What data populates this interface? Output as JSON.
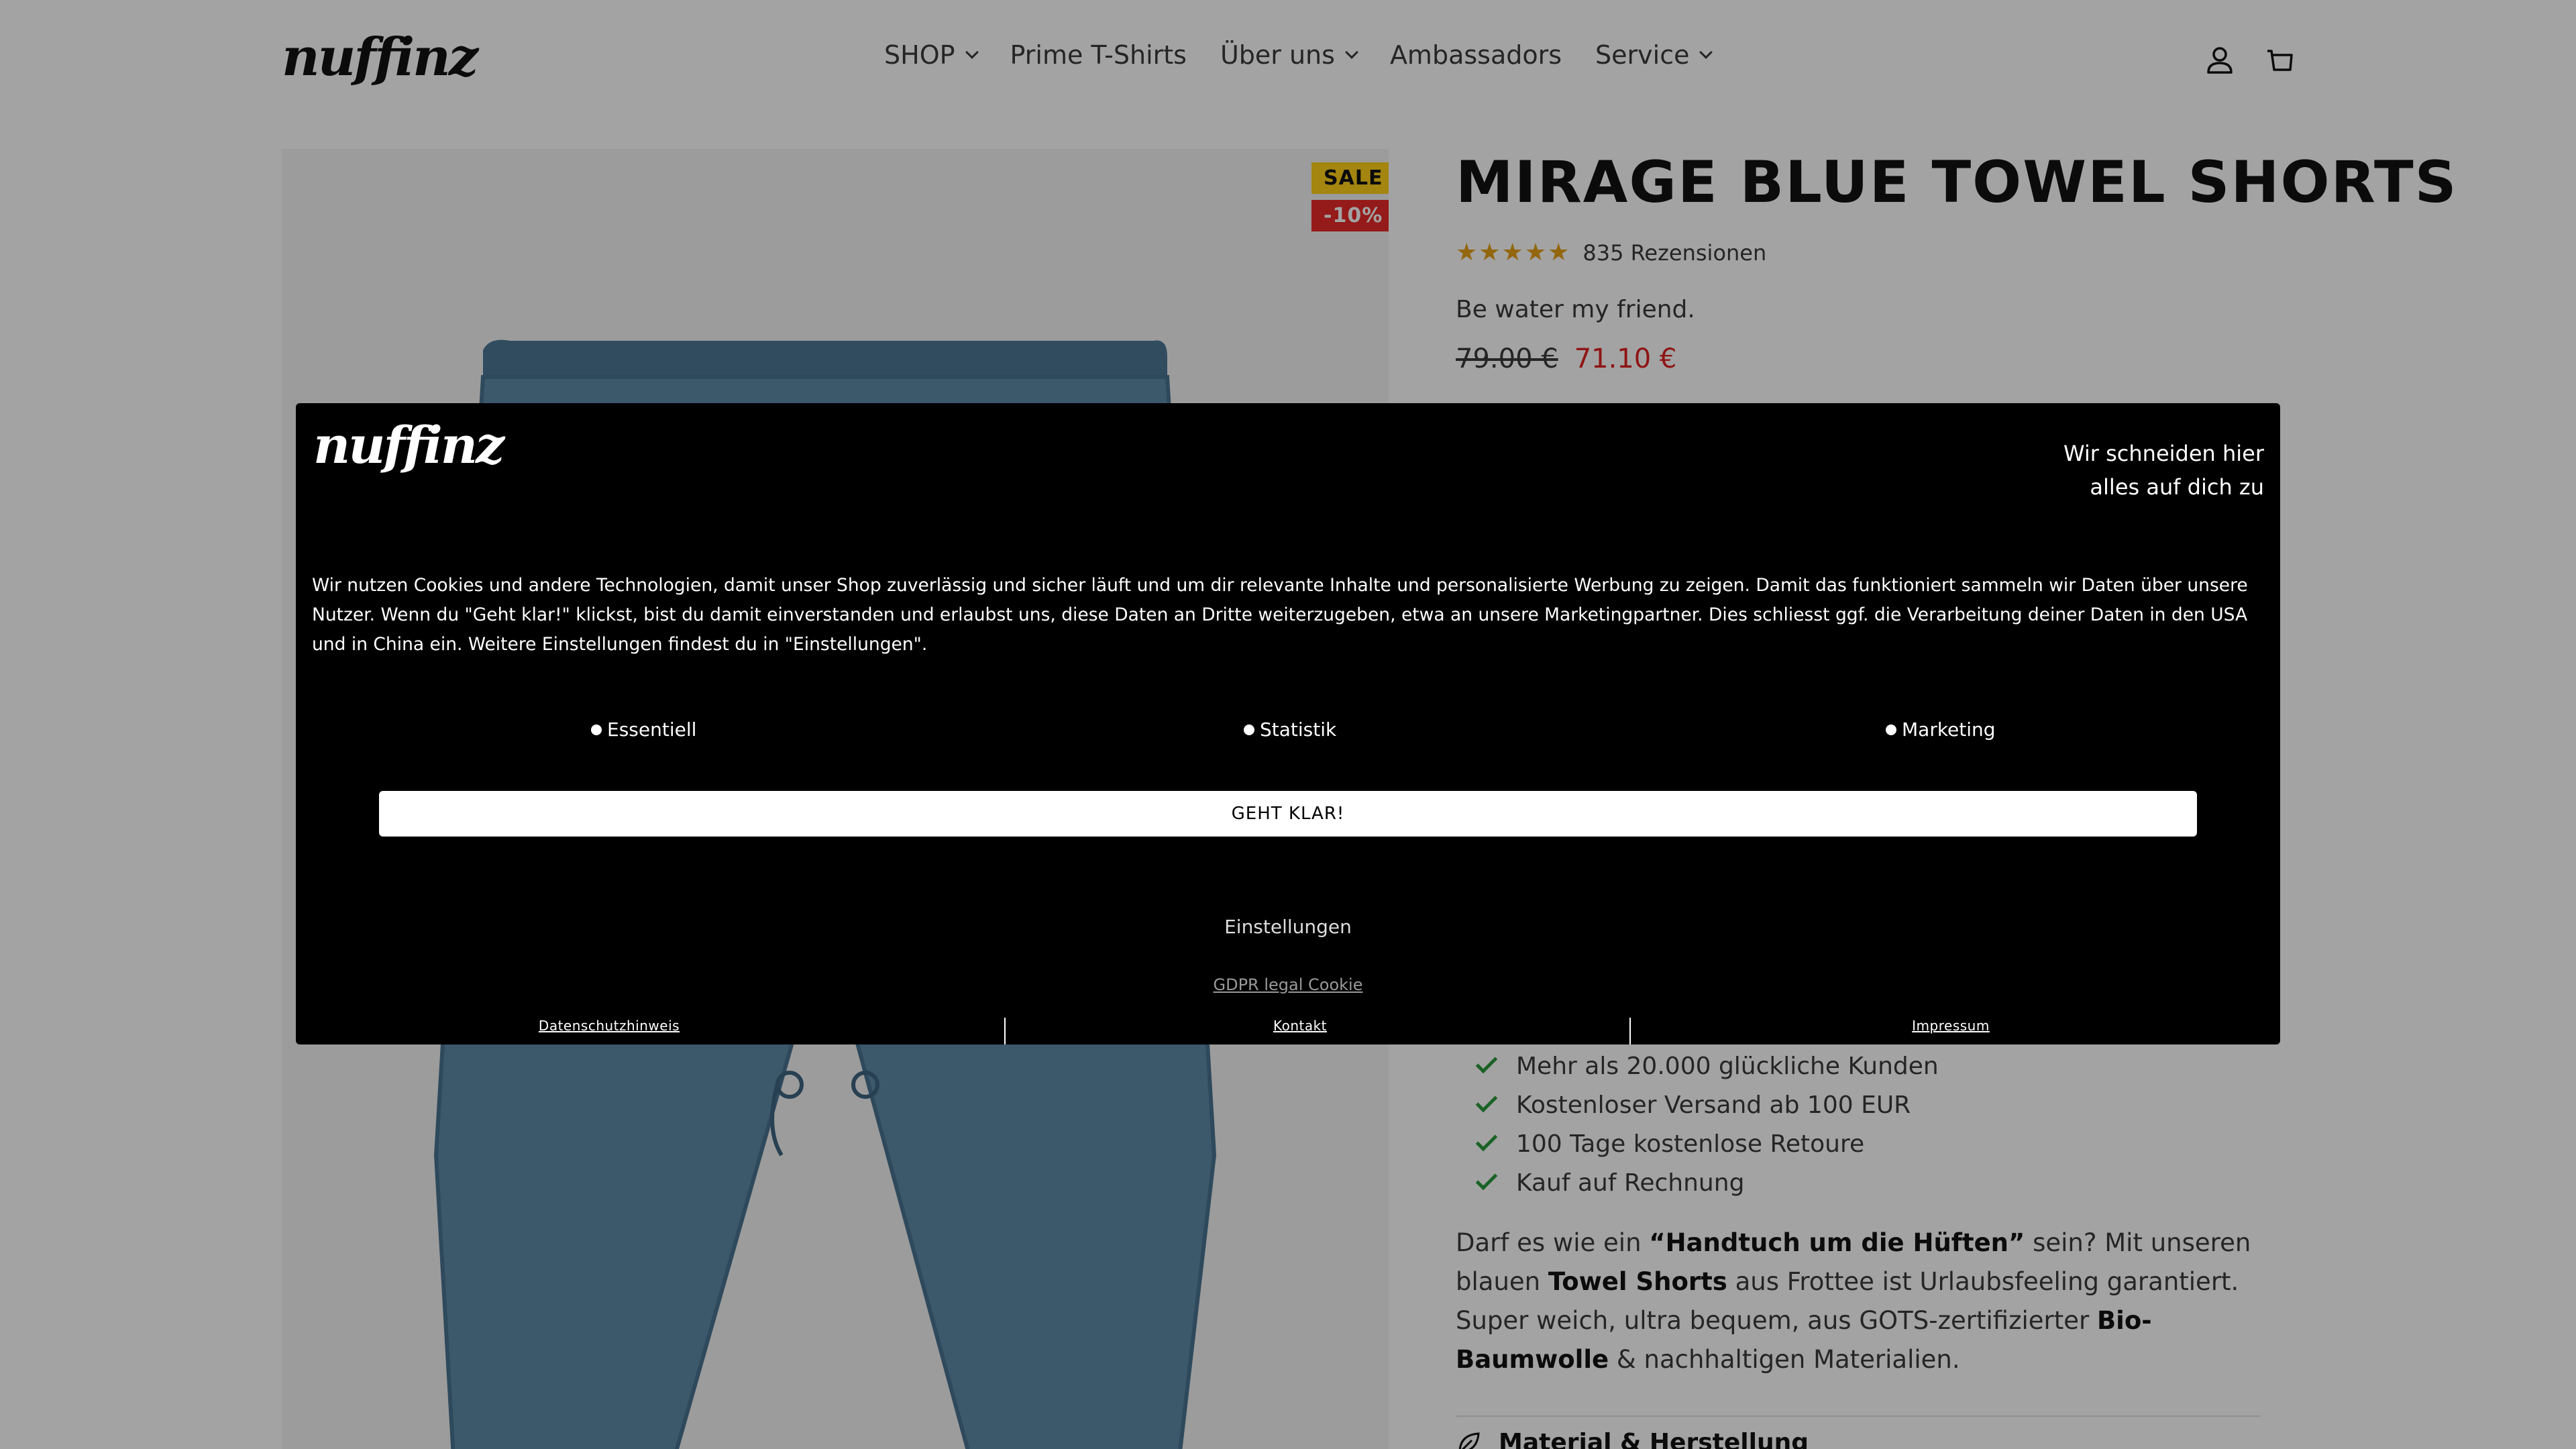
{
  "header": {
    "logo_text": "nuffinz",
    "nav": [
      {
        "label": "SHOP",
        "has_dropdown": true
      },
      {
        "label": "Prime T-Shirts",
        "has_dropdown": false
      },
      {
        "label": "Über uns",
        "has_dropdown": true
      },
      {
        "label": "Ambassadors",
        "has_dropdown": false
      },
      {
        "label": "Service",
        "has_dropdown": true
      }
    ],
    "icons": [
      "account-icon",
      "cart-icon"
    ]
  },
  "gallery": {
    "badge_sale": "SALE",
    "badge_discount": "-10%",
    "image_alt": "blue towel shorts product image"
  },
  "product": {
    "title": "MIRAGE BLUE TOWEL SHORTS",
    "stars": "★★★★★",
    "rating_value": 5,
    "reviews": "835 Rezensionen",
    "tagline": "Be water my friend.",
    "old_price": "79.00 €",
    "new_price": "71.10 €",
    "benefits": [
      "Mehr als 20.000 glückliche Kunden",
      "Kostenloser Versand ab 100 EUR",
      "100 Tage kostenlose Retoure",
      "Kauf auf Rechnung"
    ],
    "description": {
      "p1": "Darf es wie ein ",
      "b1": "“Handtuch um die Hüften”",
      "p2": " sein? Mit unseren blauen ",
      "b2": "Towel Shorts",
      "p3": " aus Frottee ist Urlaubsfeeling garantiert. Super weich, ultra bequem, aus GOTS-zertifizierter ",
      "b3": "Bio-Baumwolle",
      "p4": " & nachhaltigen Materialien."
    },
    "material_label": "Material & Herstellung"
  },
  "cookie": {
    "logo_text": "nuffinz",
    "headline_1": "Wir schneiden hier",
    "headline_2": "alles auf dich zu",
    "text": "Wir nutzen Cookies und andere Technologien, damit unser Shop zuverlässig und sicher läuft und um dir relevante Inhalte und personalisierte Werbung zu zeigen. Damit das funktioniert sammeln wir Daten über unsere Nutzer. Wenn du \"Geht klar!\" klickst, bist du damit einverstanden und erlaubst uns, diese Daten an Dritte weiterzugeben, etwa an unsere Marketingpartner. Dies schliesst ggf. die Verarbeitung deiner Daten in den USA und in China ein. Weitere Einstellungen findest du in \"Einstellungen\".",
    "options": [
      "Essentiell",
      "Statistik",
      "Marketing"
    ],
    "accept_button": "GEHT KLAR!",
    "settings_link": "Einstellungen",
    "gdpr_link": "GDPR legal Cookie",
    "footer_links": [
      "Datenschutzhinweis",
      "Kontakt",
      "Impressum"
    ]
  },
  "colors": {
    "sale_badge": "#ffd11a",
    "discount_badge": "#ea2a2a",
    "sale_price": "#e02020",
    "stars": "#e6a117",
    "check": "#2a9a3a",
    "product_blue": "#5f8aa8"
  }
}
